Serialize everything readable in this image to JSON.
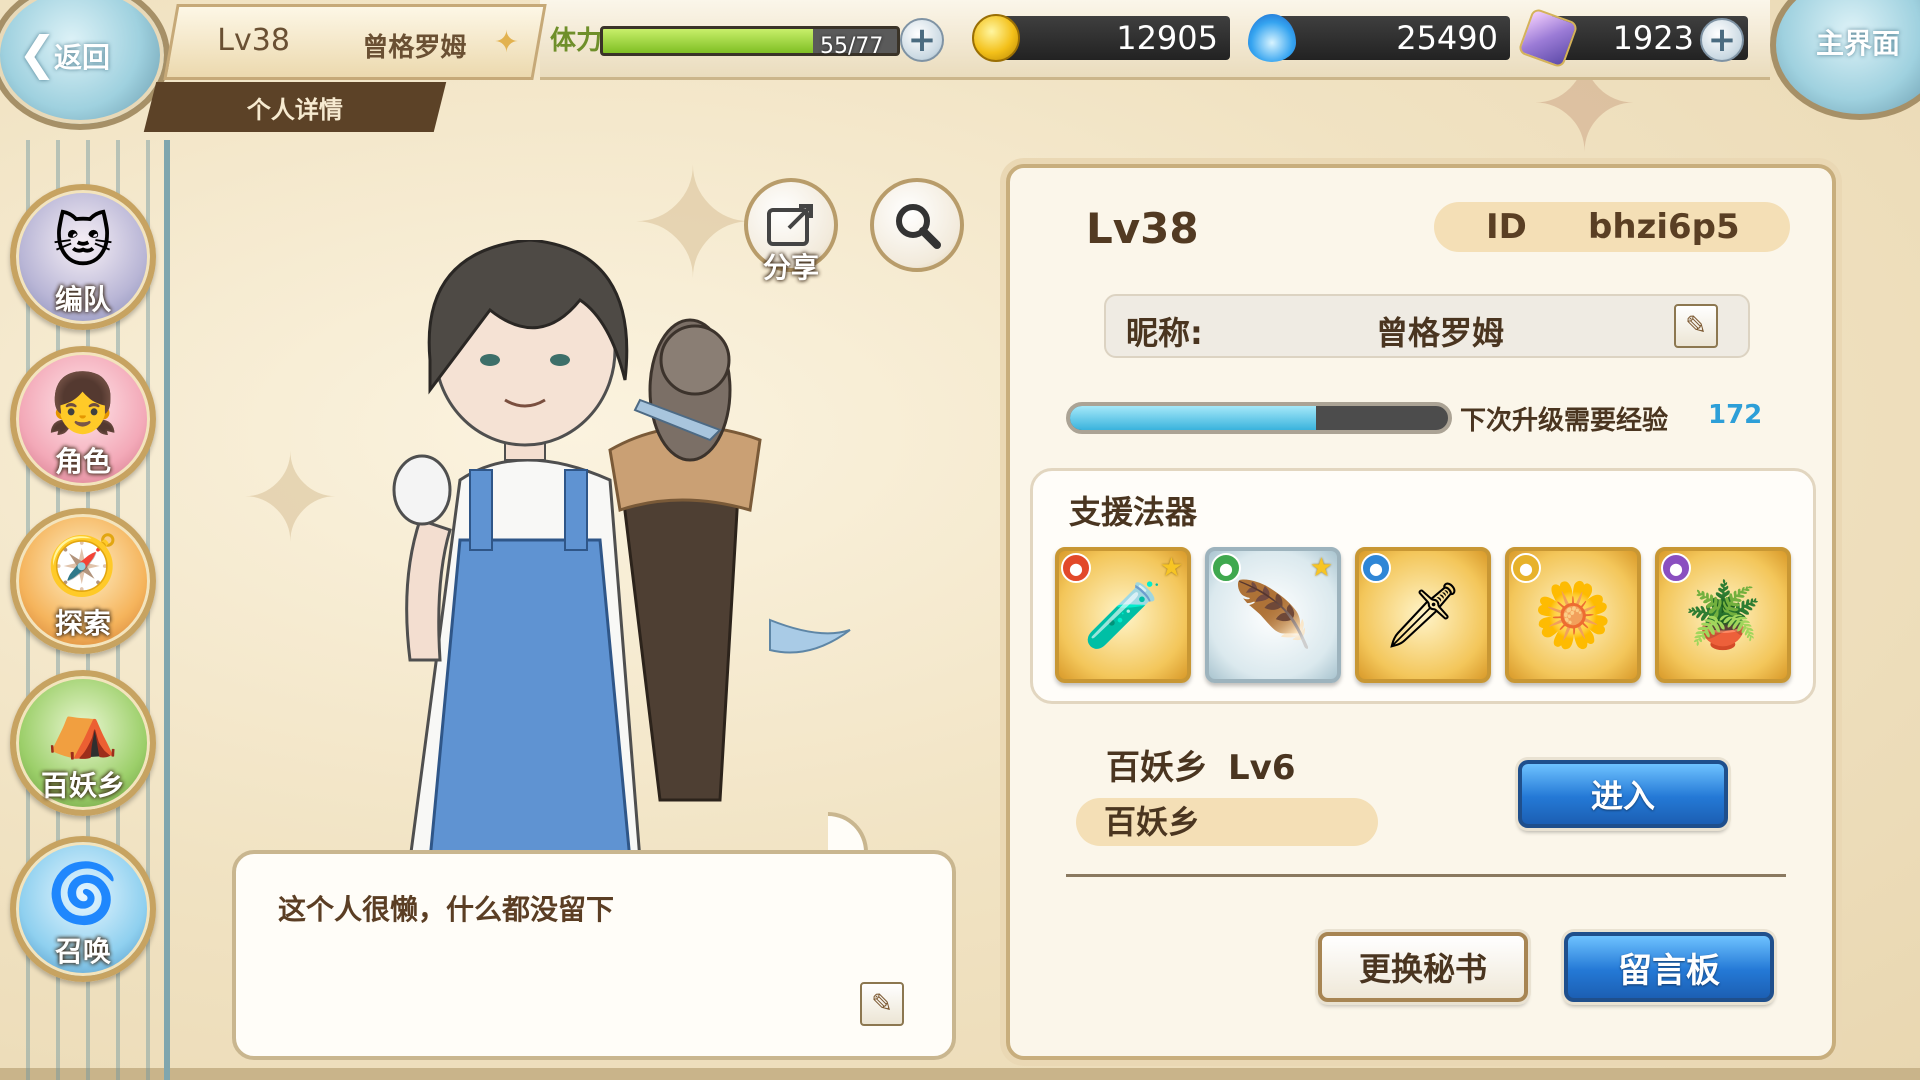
{
  "topbar": {
    "back_label": "返回",
    "player_level": "Lv38",
    "player_name": "曾格罗姆",
    "page_subtitle": "个人详情",
    "stamina_label": "体力",
    "stamina_text": "55/77",
    "stamina_fraction": 0.714,
    "gold": "12905",
    "spirit": "25490",
    "gems": "1923",
    "home_label": "主界面"
  },
  "nav": {
    "items": [
      {
        "label": "编队",
        "icon": "team-icon"
      },
      {
        "label": "角色",
        "icon": "character-icon"
      },
      {
        "label": "探索",
        "icon": "explore-icon"
      },
      {
        "label": "百妖乡",
        "icon": "village-icon"
      },
      {
        "label": "召唤",
        "icon": "summon-icon"
      }
    ]
  },
  "actions": {
    "share_label": "分享",
    "search_icon": "search-icon"
  },
  "speech": {
    "text": "这个人很懒，什么都没留下"
  },
  "profile": {
    "level": "Lv38",
    "id_label": "ID",
    "id_value": "bhzi6p5",
    "nickname_label": "昵称:",
    "nickname": "曾格罗姆",
    "exp_label": "下次升级需要经验",
    "exp_value": "172",
    "exp_fraction": 0.65,
    "support_title": "支援法器",
    "support_items": [
      {
        "name": "potion-icon",
        "element": "fire",
        "starred": true
      },
      {
        "name": "feather-icon",
        "element": "wind",
        "starred": true
      },
      {
        "name": "sword-icon",
        "element": "water",
        "starred": false
      },
      {
        "name": "flower-spear-icon",
        "element": "light",
        "starred": false
      },
      {
        "name": "mortar-icon",
        "element": "dark",
        "starred": false
      }
    ],
    "village_name": "百妖乡",
    "village_level": "Lv6",
    "village_tag": "百妖乡",
    "enter_label": "进入",
    "change_secretary_label": "更换秘书",
    "message_board_label": "留言板"
  },
  "colors": {
    "accent_blue": "#2479d6",
    "text_brown": "#4a3520",
    "exp_blue": "#2d9fd8"
  }
}
